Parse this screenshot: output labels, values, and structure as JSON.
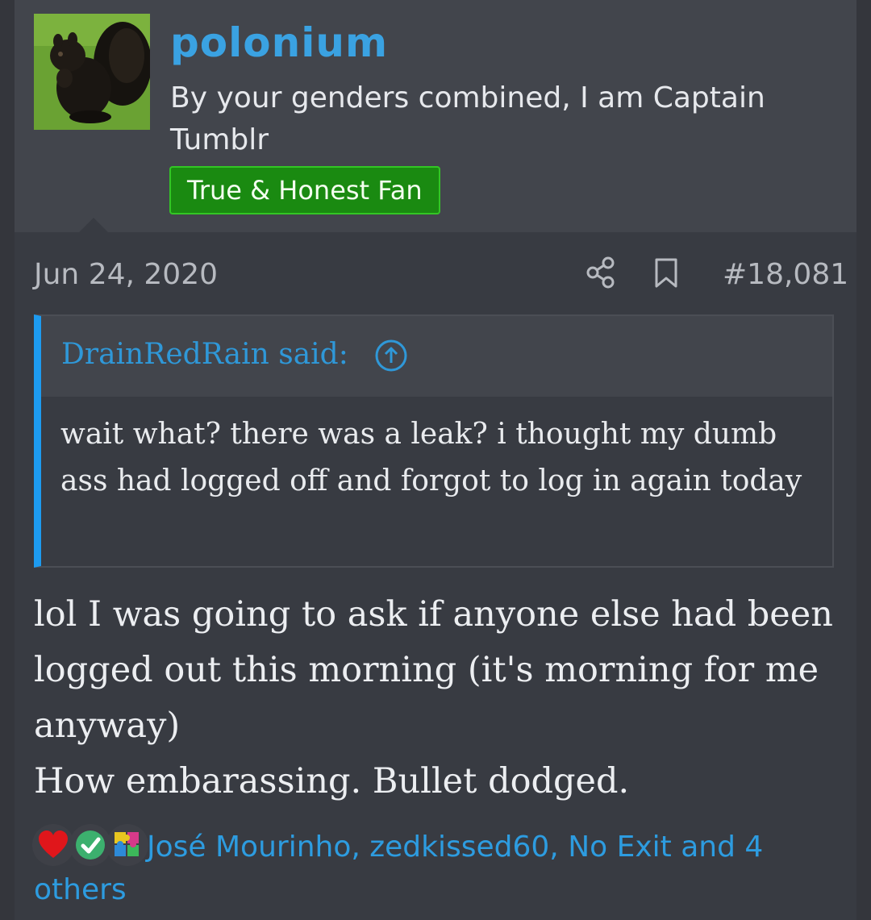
{
  "user": {
    "name": "polonium",
    "title": "By your genders combined, I am Captain Tumblr",
    "banner": "True & Honest Fan",
    "avatar_icon": "squirrel-avatar"
  },
  "post": {
    "date": "Jun 24, 2020",
    "number": "#18,081",
    "icons": [
      "share-icon",
      "bookmark-icon"
    ]
  },
  "quote": {
    "author_label": "DrainRedRain said:",
    "body": "wait what? there was a leak? i thought my dumb ass had logged off and forgot to log in again today"
  },
  "message": {
    "line1": "lol I was going to ask if anyone else had been logged out this morning (it's morning for me anyway)",
    "line2": "How embarassing. Bullet dodged."
  },
  "reactions": {
    "icons": [
      "heart-icon",
      "check-icon",
      "puzzle-icon"
    ],
    "text": "José Mourinho, zedkissed60, No Exit and 4 others"
  },
  "colors": {
    "accent": "#3aa2e2",
    "banner_bg": "#1a8a11",
    "quote_bar": "#1d9bf0"
  }
}
